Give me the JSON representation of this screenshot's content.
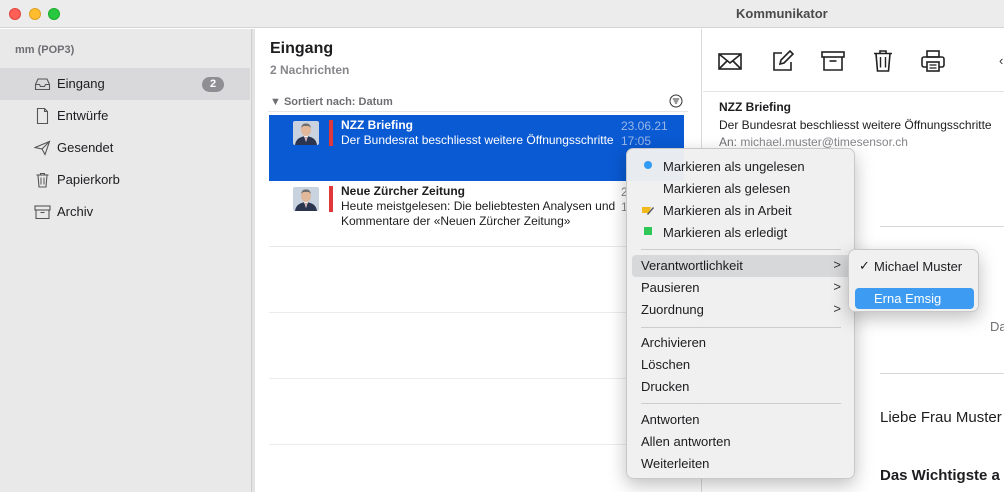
{
  "window": {
    "title": "Kommunikator"
  },
  "sidebar": {
    "account": "mm (POP3)",
    "items": [
      {
        "label": "Eingang",
        "icon": "inbox-tray-icon",
        "badge": "2"
      },
      {
        "label": "Entwürfe",
        "icon": "document-icon"
      },
      {
        "label": "Gesendet",
        "icon": "paper-plane-icon"
      },
      {
        "label": "Papierkorb",
        "icon": "trash-icon"
      },
      {
        "label": "Archiv",
        "icon": "archive-box-icon"
      }
    ]
  },
  "message_list": {
    "title": "Eingang",
    "subtitle": "2 Nachrichten",
    "sort_label": "Sortiert nach: Datum",
    "messages": [
      {
        "from": "NZZ Briefing",
        "preview": "Der Bundesrat beschliesst weitere Öffnungsschritte",
        "date": "23.06.21",
        "time": "17:05",
        "selected": true
      },
      {
        "from": "Neue Zürcher Zeitung",
        "preview": "Heute meistgelesen: Die beliebtesten Analysen und Kommentare der «Neuen Zürcher Zeitung»",
        "date": "2",
        "time": "1",
        "selected": false
      }
    ]
  },
  "reader": {
    "subject": "NZZ Briefing",
    "line": "Der Bundesrat beschliesst weitere Öffnungsschritte",
    "to_label": "An:",
    "to_address": "michael.muster@timesensor.ch",
    "fragment_da": "Da",
    "greeting": "Liebe Frau Muster",
    "bold_heading": "Das Wichtigste a",
    "toolbar": [
      "envelope-icon",
      "compose-icon",
      "archive-icon",
      "trash-icon",
      "printer-icon"
    ]
  },
  "context_menu": {
    "items": [
      {
        "label": "Markieren als ungelesen",
        "icon": "blue-dot-icon",
        "color": "#2f9bf4"
      },
      {
        "label": "Markieren als gelesen"
      },
      {
        "label": "Markieren als in Arbeit",
        "icon": "pencil-flag-icon",
        "color": "#f2b91c"
      },
      {
        "label": "Markieren als erledigt",
        "icon": "green-square-icon",
        "color": "#31c757"
      },
      {
        "label": "Verantwortlichkeit",
        "submenu": true
      },
      {
        "label": "Pausieren",
        "submenu": true
      },
      {
        "label": "Zuordnung",
        "submenu": true
      },
      {
        "label": "Archivieren"
      },
      {
        "label": "Löschen"
      },
      {
        "label": "Drucken"
      },
      {
        "label": "Antworten"
      },
      {
        "label": "Allen antworten"
      },
      {
        "label": "Weiterleiten"
      }
    ],
    "chevron": ">"
  },
  "submenu": {
    "items": [
      {
        "label": "Michael Muster",
        "checked": true,
        "check": "✓"
      },
      {
        "label": "Erna Emsig",
        "highlighted": true
      }
    ]
  }
}
